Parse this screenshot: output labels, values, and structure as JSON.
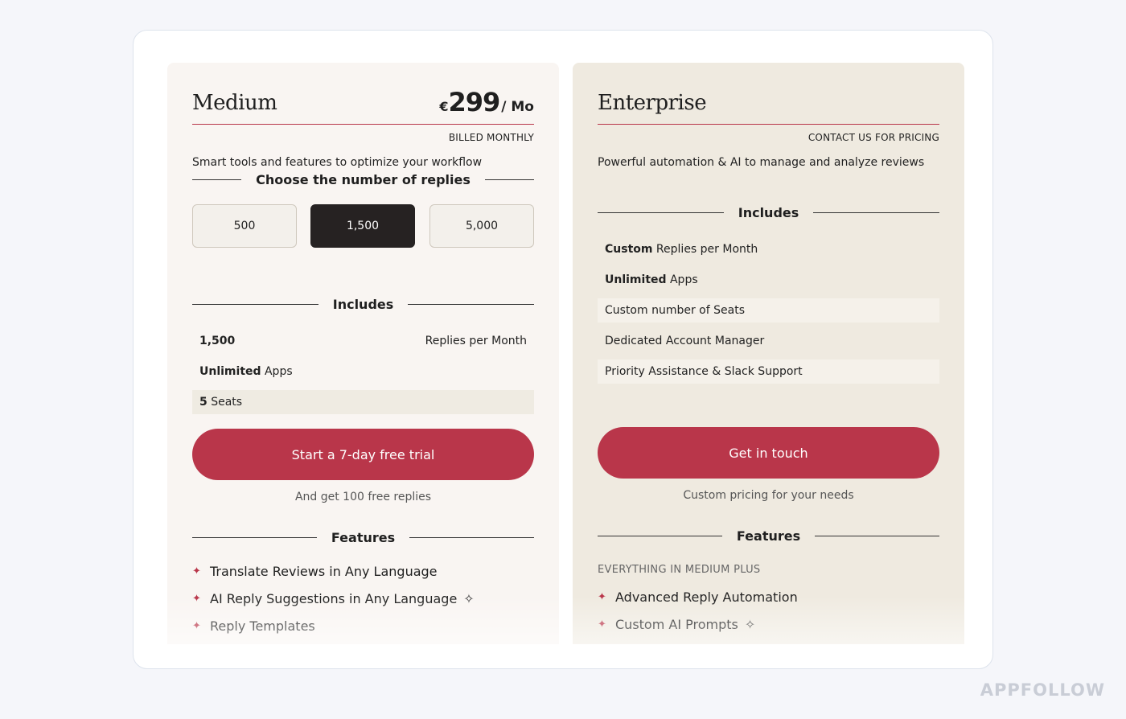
{
  "medium": {
    "name": "Medium",
    "currency": "€",
    "price": "299",
    "per": "/ Mo",
    "billing": "BILLED MONTHLY",
    "description": "Smart tools and features to optimize your workflow",
    "choose_label": "Choose the number of replies",
    "options": [
      "500",
      "1,500",
      "5,000"
    ],
    "selected_option": "1,500",
    "includes_label": "Includes",
    "includes": {
      "replies_value": "1,500",
      "replies_label": "Replies per Month",
      "apps_bold": "Unlimited",
      "apps_rest": " Apps",
      "seats_bold": "5",
      "seats_rest": " Seats"
    },
    "cta": "Start a 7-day free trial",
    "cta_sub": "And get 100 free replies",
    "features_label": "Features",
    "features": [
      "Translate Reviews in Any Language",
      "AI Reply Suggestions in Any Language",
      "Reply Templates"
    ]
  },
  "enterprise": {
    "name": "Enterprise",
    "pricing_note": "CONTACT US FOR PRICING",
    "description": "Powerful automation & AI to manage and analyze reviews",
    "includes_label": "Includes",
    "includes": {
      "replies_bold": "Custom",
      "replies_rest": " Replies per Month",
      "apps_bold": "Unlimited",
      "apps_rest": " Apps",
      "seats": "Custom number of Seats",
      "manager": "Dedicated Account Manager",
      "support": "Priority Assistance & Slack Support"
    },
    "cta": "Get in touch",
    "cta_sub": "Custom pricing for your needs",
    "features_label": "Features",
    "everything_label": "EVERYTHING IN MEDIUM PLUS",
    "features": [
      "Advanced Reply Automation",
      "Custom AI Prompts"
    ]
  },
  "watermark": "APPFOLLOW",
  "colors": {
    "accent": "#b9364a",
    "selected": "#262222",
    "medium_bg": "#f9f5f2",
    "enterprise_bg": "#efeae0"
  },
  "icons": {
    "feature_bullet": "star-icon",
    "ai_marker": "sparkle-icon"
  }
}
